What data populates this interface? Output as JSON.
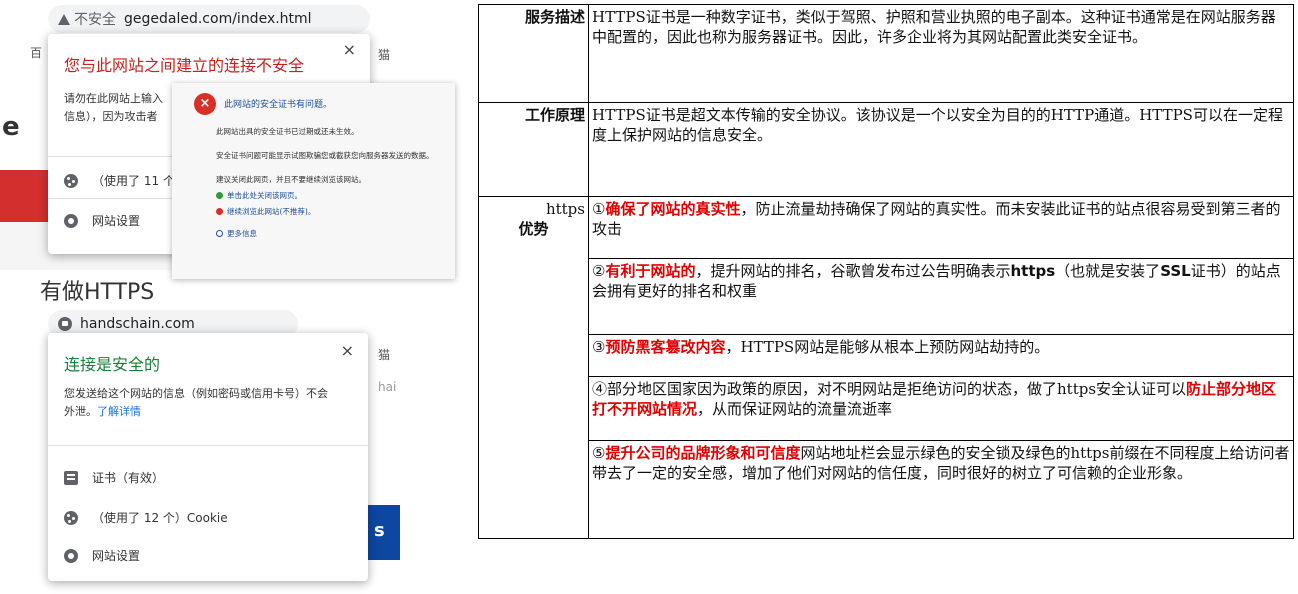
{
  "left_panel": {
    "insecure_screen": {
      "insecure_label": "不安全",
      "url": "gegedaled.com/index.html",
      "popup_title": "您与此网站之间建立的连接不安全",
      "popup_body_line1": "请勿在此网站上输入",
      "popup_body_line2": "信息），因为攻击者",
      "cookies_row": "（使用了 11 个",
      "site_settings": "网站设置",
      "bg_letter": "e",
      "side_char": "猫",
      "side_char_left": "百"
    },
    "cert_dialog": {
      "title": "此网站的安全证书有问题。",
      "line1": "此网站出具的安全证书已过期或还未生效。",
      "line2": "安全证书问题可能显示试图欺骗您或截获您向服务器发送的数据。",
      "line3": "建议关闭此网页，并且不要继续浏览该网站。",
      "link1": "单击此处关闭该网页。",
      "link2": "继续浏览此网站(不推荐)。",
      "link3": "更多信息"
    },
    "caption": "有做HTTPS",
    "secure_screen": {
      "url": "handschain.com",
      "popup_title": "连接是安全的",
      "popup_body_line1": "您发送给这个网站的信息（例如密码或信用卡号）不会",
      "popup_body_line2": "外泄。",
      "learn_more": "了解详情",
      "cert_row": "证书（有效）",
      "cookies_row": "（使用了 12 个）Cookie",
      "site_settings": "网站设置",
      "side_char": "猫",
      "side_text": "hai",
      "bg_letter": "s"
    },
    "close_symbol": "×"
  },
  "table": {
    "service": {
      "header": "服务描述",
      "text": "HTTPS证书是一种数字证书，类似于驾照、护照和营业执照的电子副本。这种证书通常是在网站服务器中配置的，因此也称为服务器证书。因此，许多企业将为其网站配置此类安全证书。"
    },
    "principle": {
      "header": "工作原理",
      "text": "HTTPS证书是超文本传输的安全协议。该协议是一个以安全为目的的HTTP通道。HTTPS可以在一定程度上保护网站的信息安全。"
    },
    "advantages": {
      "header_line1": "https",
      "header_line2": "优势",
      "items": [
        {
          "prefix": "①",
          "highlight": "确保了网站的真实性",
          "rest": "，防止流量劫持确保了网站的真实性。而未安装此证书的站点很容易受到第三者的攻击"
        },
        {
          "prefix": "②",
          "highlight": "有利于网站的",
          "rest_a": "，提升网站的排名，谷歌曾发布过公告明确表示",
          "bold_a": "https",
          "rest_b": "（也就是安装了",
          "bold_b": "SSL",
          "rest_c": "证书）的站点会拥有更好的排名和权重"
        },
        {
          "prefix": "③",
          "highlight": "预防黑客篡改内容",
          "rest": "，HTTPS网站是能够从根本上预防网站劫持的。"
        },
        {
          "prefix": "④部分地区国家因为政策的原因，对不明网站是拒绝访问的状态，做了https安全认证可以",
          "highlight": "防止部分地区打不开网站情况",
          "rest": "，从而保证网站的流量流逝率"
        },
        {
          "prefix": "⑤",
          "highlight": "提升公司的品牌形象和可信度",
          "rest": "网站地址栏会显示绿色的安全锁及绿色的https前缀在不同程度上给访问者带去了一定的安全感，增加了他们对网站的信任度，同时很好的树立了可信赖的企业形象。"
        }
      ]
    }
  }
}
